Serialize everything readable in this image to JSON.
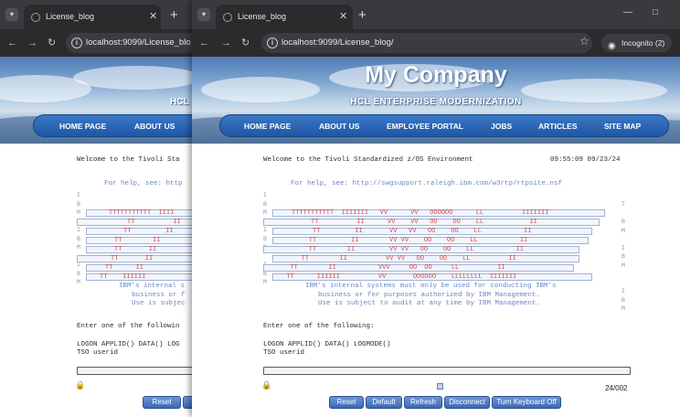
{
  "back_window": {
    "tab_title": "License_blog",
    "url": "localhost:9099/License_blo",
    "nav": [
      "HOME PAGE",
      "ABOUT US"
    ],
    "banner_fragment": "HCL",
    "welcome": "Welcome to the Tivoli Sta",
    "help": "For help, see: http",
    "logo_rows": [
      "TTTTTTTTTTT  IIII",
      "TT          II",
      "TT         II",
      "TT        II",
      "TT       II",
      "TT       II",
      "TT      II",
      "TT    IIIIII"
    ],
    "notice": [
      "IBM's internal s",
      "business or f",
      "Use is subjec"
    ],
    "prompt": "Enter one of the followin",
    "logon": "LOGON APPLID() DATA() LOG",
    "tso": "TSO userid",
    "buttons": [
      "Reset",
      "De"
    ]
  },
  "front_window": {
    "tab_title": "License_blog",
    "url": "localhost:9099/License_blog/",
    "incognito": "Incognito (2)",
    "company": "My Company",
    "subtitle": "HCL ENTERPRISE MODERNIZATION",
    "nav": [
      "HOME PAGE",
      "ABOUT US",
      "EMPLOYEE PORTAL",
      "JOBS",
      "ARTICLES",
      "SITE MAP"
    ],
    "welcome": "Welcome to the Tivoli Standardized z/OS Environment",
    "timestamp": "09:55:09 09/23/24",
    "help": "For help, see: http://swgsupport.raleigh.ibm.com/w3rtp/rtpsite.nsf",
    "logo_rows": [
      "TTTTTTTTTTT  IIIIIII   VV      VV   OOOOOO      LL          IIIIIII",
      "     TT          II      VV    VV   OO    OO    LL            II",
      "     TT         II       VV   VV   OO    OO    LL           II",
      "    TT         II        VV VV    OO    OO    LL           II",
      "    TT        II         VV VV   OO    OO    LL           II",
      "   TT        II          VV VV   OO    OO    LL          II",
      "  TT        II           VVV     OO  OO     LL          II",
      " TT      IIIIII          VV       OOOOOO    LLLLLLLL  IIIIIII"
    ],
    "left_chars": [
      "I",
      "B",
      "M",
      "",
      "I",
      "B",
      "M",
      "",
      "I",
      "B",
      "M"
    ],
    "right_chars": [
      "T",
      "",
      "B",
      "M",
      "",
      "I",
      "B",
      "M",
      "",
      "",
      "I",
      "B",
      "M"
    ],
    "notice": [
      "IBM's internal systems must only be used for conducting IBM's",
      "business or for purposes authorized by IBM Management.",
      "Use is subject to audit at any time by IBM Management."
    ],
    "prompt": "Enter one of the following:",
    "logon": "LOGON APPLID() DATA() LOGMODE()",
    "tso": "TSO userid",
    "cursor_pos": "24/002",
    "buttons": [
      "Reset",
      "Default",
      "Refresh",
      "Disconnect",
      "Turn Keyboard Off"
    ]
  },
  "colors": {
    "tab_bg": "#3a3a3e",
    "toolbar_bg": "#2b2b2e",
    "nav_blue": "#1e57a6",
    "terminal_red": "#d2474b",
    "terminal_blue": "#6c86c4"
  },
  "icons": [
    "tab-favicon-icon",
    "close-icon",
    "new-tab-icon",
    "back-icon",
    "forward-icon",
    "reload-icon",
    "site-info-icon",
    "star-icon",
    "incognito-icon",
    "minimize-icon",
    "maximize-icon",
    "lock-icon",
    "keyboard-icon"
  ]
}
